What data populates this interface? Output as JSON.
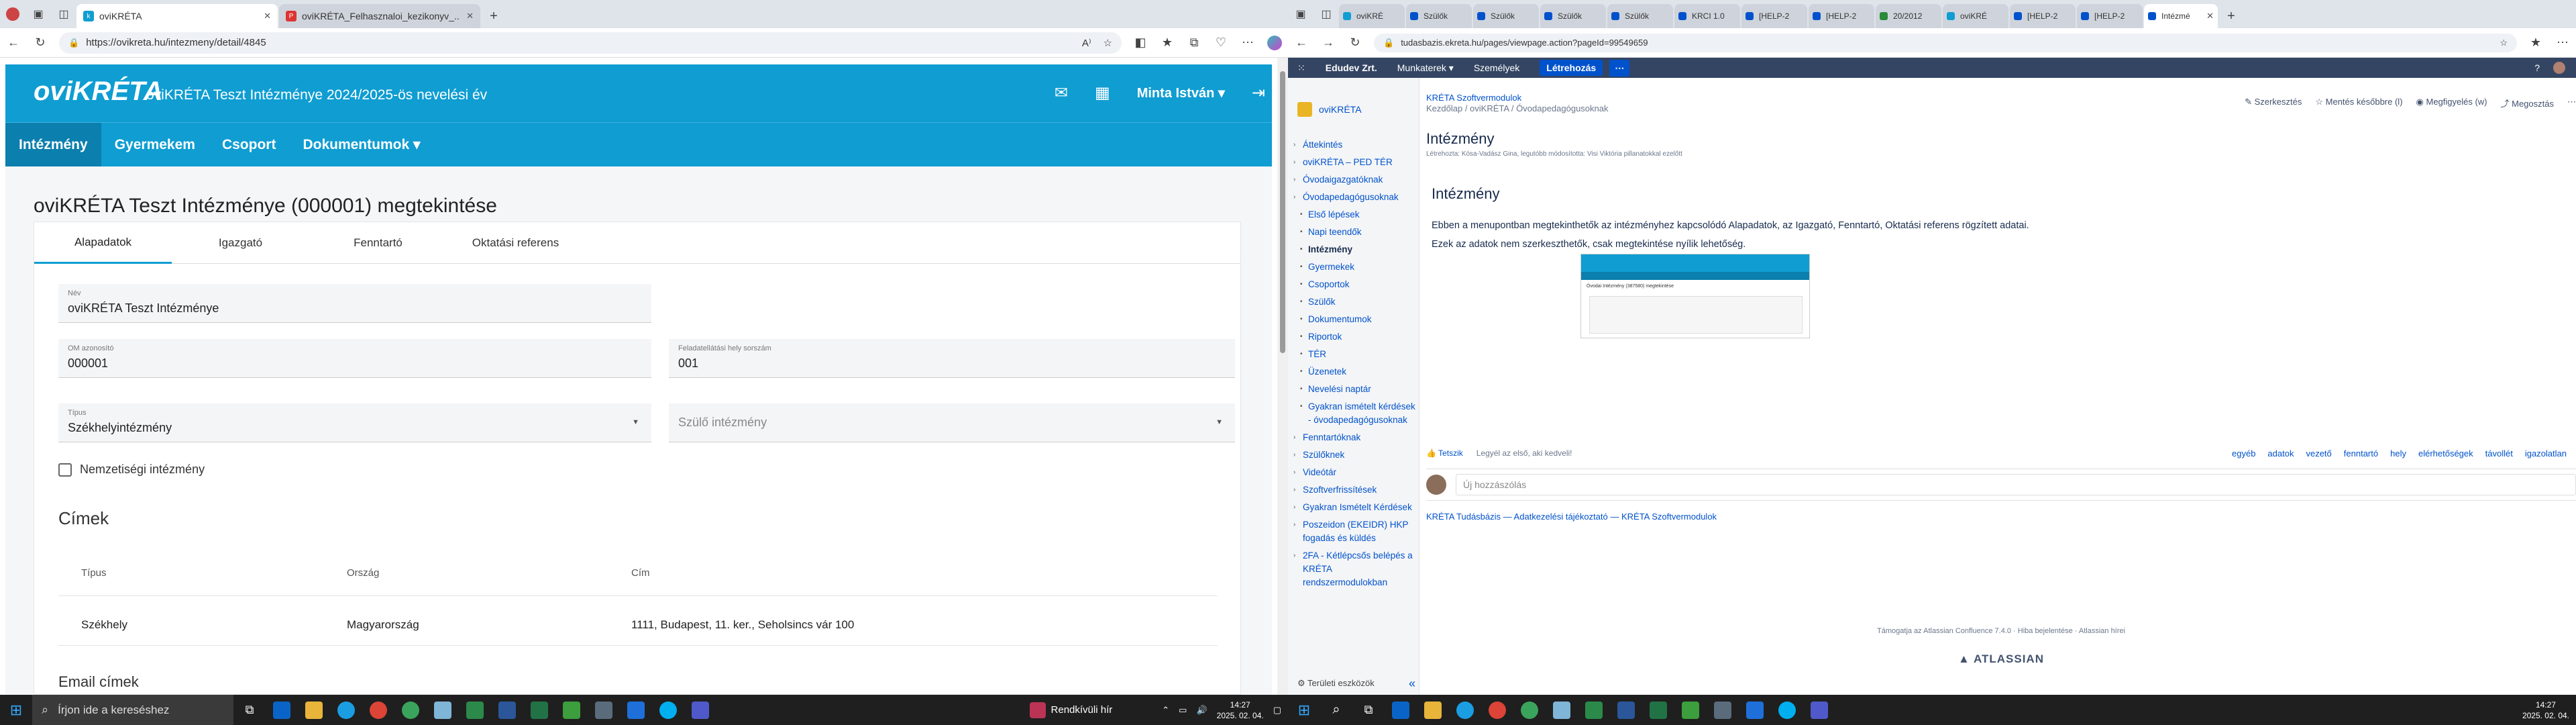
{
  "left_browser": {
    "tabs": [
      {
        "label": "oviKRÉTA",
        "active": true
      },
      {
        "label": "oviKRÉTA_Felhasznaloi_kezikonyv_..",
        "active": false
      }
    ],
    "url": "https://ovikreta.hu/intezmeny/detail/4845"
  },
  "app": {
    "logo": "oviKRÉTA",
    "institution_title": "oviKRÉTA Teszt Intézménye  2024/2025-ös nevelési év",
    "user": "Minta István ▾",
    "nav": [
      "Intézmény",
      "Gyermekem",
      "Csoport",
      "Dokumentumok ▾"
    ],
    "page_title": "oviKRÉTA Teszt Intézménye (000001) megtekintése",
    "tabs": [
      "Alapadatok",
      "Igazgató",
      "Fenntartó",
      "Oktatási referens"
    ],
    "fields": {
      "name_label": "Név",
      "name_value": "oviKRÉTA Teszt Intézménye",
      "om_label": "OM azonosító",
      "om_value": "000001",
      "site_label": "Feladatellátási hely sorszám",
      "site_value": "001",
      "type_label": "Típus",
      "type_value": "Székhelyintézmény",
      "parent_placeholder": "Szülő intézmény"
    },
    "nationality_checkbox": "Nemzetiségi intézmény",
    "addresses_title": "Címek",
    "address_headers": [
      "Típus",
      "Ország",
      "Cím"
    ],
    "address_rows": [
      [
        "Székhely",
        "Magyarország",
        "1111, Budapest, 11. ker., Seholsincs vár 100"
      ]
    ],
    "next_section": "Email címek"
  },
  "right_browser": {
    "tabs": [
      "oviKRÉ",
      "Szülők",
      "Szülők",
      "Szülők",
      "Szülők",
      "KRCI 1.0",
      "[HELP-2",
      "[HELP-2",
      "20/2012",
      "oviKRÉ",
      "[HELP-2",
      "[HELP-2",
      "Intézmé"
    ],
    "url": "tudasbazis.ekreta.hu/pages/viewpage.action?pageId=99549659"
  },
  "confluence": {
    "top": [
      "Edudev Zrt.",
      "Munkaterek ▾",
      "Személyek"
    ],
    "create_label": "Létrehozás",
    "space_name": "oviKRÉTA",
    "tree": [
      {
        "label": "Áttekintés",
        "level": 1
      },
      {
        "label": "oviKRÉTA – PED TÉR",
        "level": 1
      },
      {
        "label": "Óvodaigazgatóknak",
        "level": 1
      },
      {
        "label": "Óvodapedagógusoknak",
        "level": 1
      },
      {
        "label": "Első lépések",
        "level": 2
      },
      {
        "label": "Napi teendők",
        "level": 2
      },
      {
        "label": "Intézmény",
        "level": 2,
        "current": true
      },
      {
        "label": "Gyermekek",
        "level": 2
      },
      {
        "label": "Csoportok",
        "level": 2
      },
      {
        "label": "Szülők",
        "level": 2
      },
      {
        "label": "Dokumentumok",
        "level": 2
      },
      {
        "label": "Riportok",
        "level": 2
      },
      {
        "label": "TÉR",
        "level": 2
      },
      {
        "label": "Üzenetek",
        "level": 2
      },
      {
        "label": "Nevelési naptár",
        "level": 2
      },
      {
        "label": "Gyakran ismételt kérdések - óvodapedagógusoknak",
        "level": 2
      },
      {
        "label": "Fenntartóknak",
        "level": 1
      },
      {
        "label": "Szülőknek",
        "level": 1
      },
      {
        "label": "Videótár",
        "level": 1
      },
      {
        "label": "Szoftverfrissítések",
        "level": 1
      },
      {
        "label": "Gyakran Ismételt Kérdések",
        "level": 1
      },
      {
        "label": "Poszeidon (EKEIDR) HKP fogadás és küldés",
        "level": 1
      },
      {
        "label": "2FA - Kétlépcsős belépés a KRÉTA rendszermodulokban",
        "level": 1
      }
    ],
    "settings": "Területi eszközök",
    "breadcrumb_space": "KRÉTA Szoftvermodulok",
    "breadcrumb": "Kezdőlap  /  oviKRÉTA  /  Óvodapedagógusoknak",
    "actions": [
      "✎ Szerkesztés",
      "☆ Mentés későbbre (l)",
      "◉ Megfigyelés (w)",
      "⤴ Megosztás"
    ],
    "title": "Intézmény",
    "meta": "Létrehozta: Kósa-Vadász Gina, legutóbb módosította: Visi Viktória  pillanatokkal ezelőtt",
    "h2": "Intézmény",
    "p1": "Ebben a menupontban megtekinthetők az intézményhez kapcsolódó Alapadatok, az Igazgató, Fenntartó, Oktatási referens rögzített adatai.",
    "p2": "Ezek az adatok nem szerkeszthetők, csak megtekintése nyílik lehetőség.",
    "thumb_title": "Óvodai Intézmény (387580) megtekintése",
    "like": "👍 Tetszik",
    "like_text": "Legyél az első, aki kedveli!",
    "labels": [
      "egyéb",
      "adatok",
      "vezető",
      "fenntartó",
      "hely",
      "elérhetőségek",
      "távollét",
      "igazolatlan"
    ],
    "comment_placeholder": "Új hozzászólás",
    "footer": "KRÉTA Tudásbázis  —  Adatkezelési tájékoztató  —  KRÉTA Szoftvermodulok",
    "powered": "Támogatja az Atlassian Confluence 7.4.0  ·  Hiba bejelentése  ·  Atlassian hírei",
    "atlassian": "▲ ATLASSIAN"
  },
  "taskbar_left": {
    "search_placeholder": "Írjon ide a kereséshez",
    "news": "Rendkívüli hír",
    "time": "14:27",
    "date": "2025. 02. 04."
  },
  "taskbar_right": {
    "time": "14:27",
    "date": "2025. 02. 04."
  }
}
